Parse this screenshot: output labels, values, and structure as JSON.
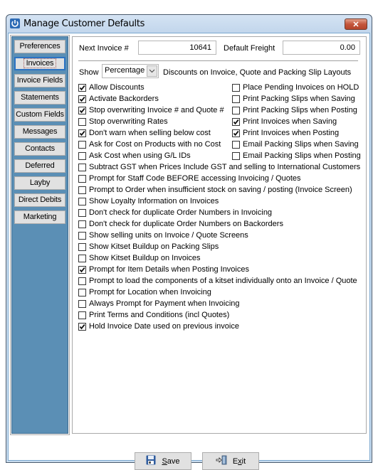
{
  "window": {
    "title": "Manage Customer Defaults",
    "close_label": "✕"
  },
  "sidebar": {
    "items": [
      {
        "label": "Preferences",
        "active": false
      },
      {
        "label": "Invoices",
        "active": true
      },
      {
        "label": "Invoice Fields",
        "active": false
      },
      {
        "label": "Statements",
        "active": false
      },
      {
        "label": "Custom Fields",
        "active": false
      },
      {
        "label": "Messages",
        "active": false
      },
      {
        "label": "Contacts",
        "active": false
      },
      {
        "label": "Deferred",
        "active": false
      },
      {
        "label": "Layby",
        "active": false
      },
      {
        "label": "Direct Debits",
        "active": false
      },
      {
        "label": "Marketing",
        "active": false
      }
    ]
  },
  "main": {
    "next_invoice_label": "Next Invoice #",
    "next_invoice_value": "10641",
    "default_freight_label": "Default Freight",
    "default_freight_value": "0.00",
    "show_label": "Show",
    "show_select_value": "Percentage",
    "discounts_label": "Discounts on Invoice, Quote and Packing Slip Layouts",
    "left_options": [
      {
        "label": "Allow Discounts",
        "checked": true
      },
      {
        "label": "Activate Backorders",
        "checked": true
      },
      {
        "label": "Stop overwriting Invoice # and Quote #",
        "checked": true
      },
      {
        "label": "Stop overwriting Rates",
        "checked": false
      },
      {
        "label": "Don't warn when selling below cost",
        "checked": true
      },
      {
        "label": "Ask for Cost on Products with no Cost",
        "checked": false
      },
      {
        "label": "Ask Cost when using G/L IDs",
        "checked": false
      }
    ],
    "right_options": [
      {
        "label": "Place Pending Invoices on HOLD",
        "checked": false
      },
      {
        "label": "Print Packing Slips when Saving",
        "checked": false
      },
      {
        "label": "Print Packing Slips when Posting",
        "checked": false
      },
      {
        "label": "Print Invoices when Saving",
        "checked": true
      },
      {
        "label": "Print Invoices when Posting",
        "checked": true
      },
      {
        "label": "Email Packing Slips when Saving",
        "checked": false
      },
      {
        "label": "Email Packing Slips when Posting",
        "checked": false
      }
    ],
    "full_options": [
      {
        "label": "Subtract GST when Prices Include GST and selling to International Customers",
        "checked": false
      },
      {
        "label": "Prompt for Staff Code BEFORE accessing Invoicing / Quotes",
        "checked": false
      },
      {
        "label": "Prompt to Order when insufficient stock on saving / posting (Invoice Screen)",
        "checked": false
      },
      {
        "label": "Show Loyalty Information on Invoices",
        "checked": false
      },
      {
        "label": "Don't check for duplicate Order Numbers in Invoicing",
        "checked": false
      },
      {
        "label": "Don't check for duplicate Order Numbers on Backorders",
        "checked": false
      },
      {
        "label": "Show selling units on Invoice / Quote Screens",
        "checked": false
      },
      {
        "label": "Show Kitset Buildup on Packing Slips",
        "checked": false
      },
      {
        "label": "Show Kitset Buildup on Invoices",
        "checked": false
      },
      {
        "label": "Prompt for Item Details when Posting Invoices",
        "checked": true
      },
      {
        "label": "Prompt to load the components of a kitset individually onto an Invoice / Quote",
        "checked": false
      },
      {
        "label": "Prompt for Location when Invoicing",
        "checked": false
      },
      {
        "label": "Always Prompt for Payment when Invoicing",
        "checked": false
      },
      {
        "label": "Print Terms and Conditions (incl Quotes)",
        "checked": false
      },
      {
        "label": "Hold Invoice Date used on previous invoice",
        "checked": true
      }
    ]
  },
  "footer": {
    "save_first": "S",
    "save_rest": "ave",
    "exit_first": "E",
    "exit_mid": "x",
    "exit_rest": "it"
  }
}
